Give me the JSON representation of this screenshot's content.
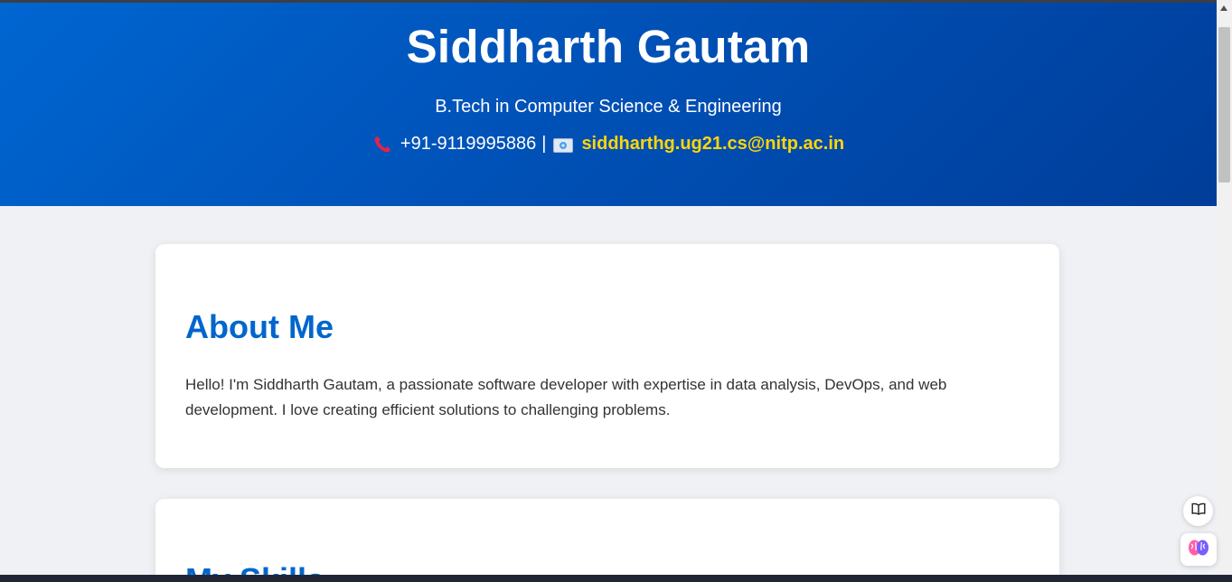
{
  "header": {
    "name": "Siddharth Gautam",
    "degree": "B.Tech in Computer Science & Engineering",
    "phone": "+91-9119995886",
    "separator": "|",
    "email": "siddharthg.ug21.cs@nitp.ac.in"
  },
  "about": {
    "title": "About Me",
    "text": "Hello! I'm Siddharth Gautam, a passionate software developer with expertise in data analysis, DevOps, and web development. I love creating efficient solutions to challenging problems."
  },
  "skills": {
    "title": "My Skills"
  },
  "icons": {
    "phone": "phone-icon",
    "mail": "envelope-icon",
    "reader": "book-icon",
    "assistant": "brain-icon"
  },
  "colors": {
    "header_gradient_start": "#0066d1",
    "header_gradient_end": "#003d99",
    "accent": "#0066cc",
    "email": "#ffd60a",
    "page_bg": "#f0f1f4"
  }
}
